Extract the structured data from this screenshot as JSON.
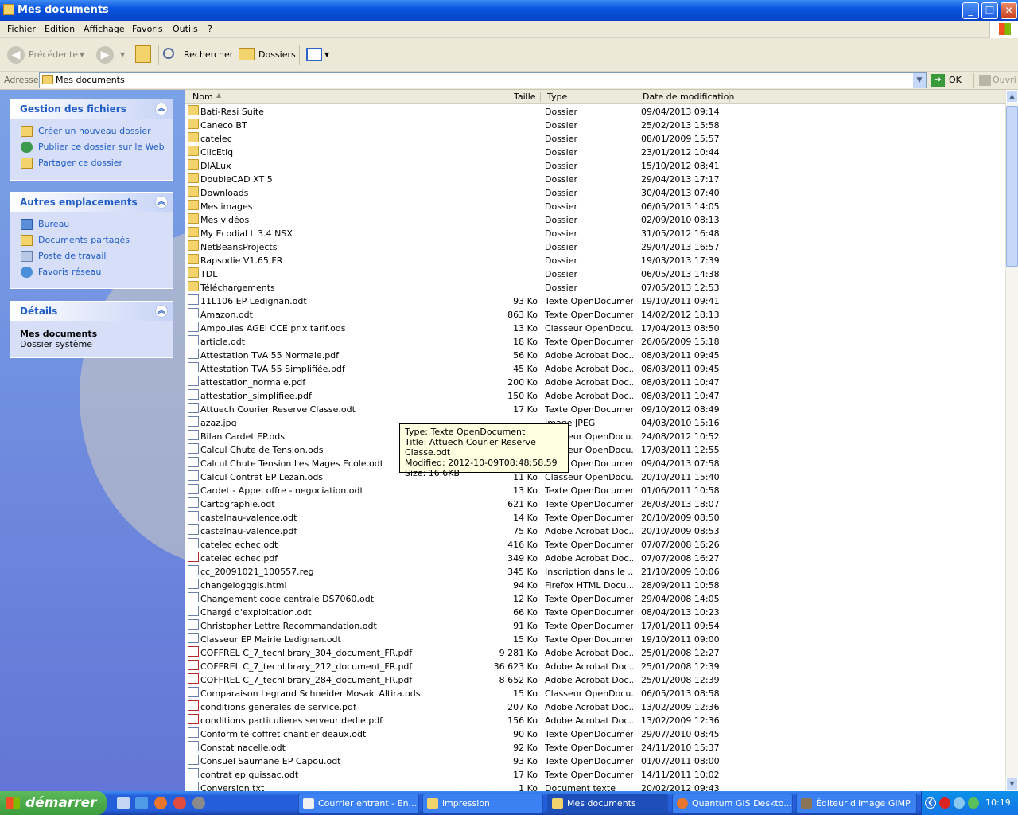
{
  "window": {
    "title": "Mes documents"
  },
  "menu": [
    "Fichier",
    "Edition",
    "Affichage",
    "Favoris",
    "Outils",
    "?"
  ],
  "toolbar": {
    "back": "Précédente",
    "search": "Rechercher",
    "folders": "Dossiers"
  },
  "address": {
    "label": "Adresse",
    "value": "Mes documents",
    "go": "OK",
    "open": "Ouvri"
  },
  "tasks_panel": {
    "title": "Gestion des fichiers",
    "items": [
      "Créer un nouveau dossier",
      "Publier ce dossier sur le Web",
      "Partager ce dossier"
    ]
  },
  "places_panel": {
    "title": "Autres emplacements",
    "items": [
      "Bureau",
      "Documents partagés",
      "Poste de travail",
      "Favoris réseau"
    ]
  },
  "details_panel": {
    "title": "Détails",
    "name": "Mes documents",
    "desc": "Dossier système"
  },
  "columns": {
    "name": "Nom",
    "size": "Taille",
    "type": "Type",
    "date": "Date de modification"
  },
  "files": [
    {
      "name": "Bati-Resi Suite",
      "size": "",
      "type": "Dossier",
      "date": "09/04/2013 09:14",
      "kind": "folder"
    },
    {
      "name": "Caneco BT",
      "size": "",
      "type": "Dossier",
      "date": "25/02/2013 15:58",
      "kind": "folder"
    },
    {
      "name": "catelec",
      "size": "",
      "type": "Dossier",
      "date": "08/01/2009 15:57",
      "kind": "folder"
    },
    {
      "name": "ClicEtiq",
      "size": "",
      "type": "Dossier",
      "date": "23/01/2012 10:44",
      "kind": "folder"
    },
    {
      "name": "DIALux",
      "size": "",
      "type": "Dossier",
      "date": "15/10/2012 08:41",
      "kind": "folder"
    },
    {
      "name": "DoubleCAD XT 5",
      "size": "",
      "type": "Dossier",
      "date": "29/04/2013 17:17",
      "kind": "folder"
    },
    {
      "name": "Downloads",
      "size": "",
      "type": "Dossier",
      "date": "30/04/2013 07:40",
      "kind": "folder"
    },
    {
      "name": "Mes images",
      "size": "",
      "type": "Dossier",
      "date": "06/05/2013 14:05",
      "kind": "folder"
    },
    {
      "name": "Mes vidéos",
      "size": "",
      "type": "Dossier",
      "date": "02/09/2010 08:13",
      "kind": "folder"
    },
    {
      "name": "My Ecodial L 3.4 NSX",
      "size": "",
      "type": "Dossier",
      "date": "31/05/2012 16:48",
      "kind": "folder"
    },
    {
      "name": "NetBeansProjects",
      "size": "",
      "type": "Dossier",
      "date": "29/04/2013 16:57",
      "kind": "folder"
    },
    {
      "name": "Rapsodie V1.65 FR",
      "size": "",
      "type": "Dossier",
      "date": "19/03/2013 17:39",
      "kind": "folder"
    },
    {
      "name": "TDL",
      "size": "",
      "type": "Dossier",
      "date": "06/05/2013 14:38",
      "kind": "folder"
    },
    {
      "name": "Téléchargements",
      "size": "",
      "type": "Dossier",
      "date": "07/05/2013 12:53",
      "kind": "folder"
    },
    {
      "name": "11L106 EP Ledignan.odt",
      "size": "93 Ko",
      "type": "Texte OpenDocument",
      "date": "19/10/2011 09:41",
      "kind": "doc"
    },
    {
      "name": "Amazon.odt",
      "size": "863 Ko",
      "type": "Texte OpenDocument",
      "date": "14/02/2012 18:13",
      "kind": "doc"
    },
    {
      "name": "Ampoules AGEI CCE prix tarif.ods",
      "size": "13 Ko",
      "type": "Classeur OpenDocu...",
      "date": "17/04/2013 08:50",
      "kind": "doc"
    },
    {
      "name": "article.odt",
      "size": "18 Ko",
      "type": "Texte OpenDocument",
      "date": "26/06/2009 15:18",
      "kind": "doc"
    },
    {
      "name": "Attestation TVA 55 Normale.pdf",
      "size": "56 Ko",
      "type": "Adobe Acrobat Doc...",
      "date": "08/03/2011 09:45",
      "kind": "doc"
    },
    {
      "name": "Attestation TVA 55 Simplifiée.pdf",
      "size": "45 Ko",
      "type": "Adobe Acrobat Doc...",
      "date": "08/03/2011 09:45",
      "kind": "doc"
    },
    {
      "name": "attestation_normale.pdf",
      "size": "200 Ko",
      "type": "Adobe Acrobat Doc...",
      "date": "08/03/2011 10:47",
      "kind": "doc"
    },
    {
      "name": "attestation_simplifiee.pdf",
      "size": "150 Ko",
      "type": "Adobe Acrobat Doc...",
      "date": "08/03/2011 10:47",
      "kind": "doc"
    },
    {
      "name": "Attuech Courier Reserve Classe.odt",
      "size": "17 Ko",
      "type": "Texte OpenDocument",
      "date": "09/10/2012 08:49",
      "kind": "doc"
    },
    {
      "name": "azaz.jpg",
      "size": "",
      "type": "Image JPEG",
      "date": "04/03/2010 15:16",
      "kind": "doc"
    },
    {
      "name": "Bilan Cardet EP.ods",
      "size": "",
      "type": "Classeur OpenDocu...",
      "date": "24/08/2012 10:52",
      "kind": "doc"
    },
    {
      "name": "Calcul Chute de Tension.ods",
      "size": "",
      "type": "Classeur OpenDocu...",
      "date": "17/03/2011 12:55",
      "kind": "doc"
    },
    {
      "name": "Calcul Chute Tension Les Mages Ecole.odt",
      "size": "",
      "type": "Texte OpenDocument",
      "date": "09/04/2013 07:58",
      "kind": "doc"
    },
    {
      "name": "Calcul Contrat EP Lezan.ods",
      "size": "11 Ko",
      "type": "Classeur OpenDocu...",
      "date": "20/10/2011 15:40",
      "kind": "doc"
    },
    {
      "name": "Cardet - Appel offre - negociation.odt",
      "size": "13 Ko",
      "type": "Texte OpenDocument",
      "date": "01/06/2011 10:58",
      "kind": "doc"
    },
    {
      "name": "Cartographie.odt",
      "size": "621 Ko",
      "type": "Texte OpenDocument",
      "date": "26/03/2013 18:07",
      "kind": "doc"
    },
    {
      "name": "castelnau-valence.odt",
      "size": "14 Ko",
      "type": "Texte OpenDocument",
      "date": "20/10/2009 08:50",
      "kind": "doc"
    },
    {
      "name": "castelnau-valence.pdf",
      "size": "75 Ko",
      "type": "Adobe Acrobat Doc...",
      "date": "20/10/2009 08:53",
      "kind": "doc"
    },
    {
      "name": "catelec echec.odt",
      "size": "416 Ko",
      "type": "Texte OpenDocument",
      "date": "07/07/2008 16:26",
      "kind": "doc"
    },
    {
      "name": "catelec echec.pdf",
      "size": "349 Ko",
      "type": "Adobe Acrobat Doc...",
      "date": "07/07/2008 16:27",
      "kind": "pdf"
    },
    {
      "name": "cc_20091021_100557.reg",
      "size": "345 Ko",
      "type": "Inscription dans le ...",
      "date": "21/10/2009 10:06",
      "kind": "doc"
    },
    {
      "name": "changelogqgis.html",
      "size": "94 Ko",
      "type": "Firefox HTML Docu...",
      "date": "28/09/2011 10:58",
      "kind": "doc"
    },
    {
      "name": "Changement code centrale DS7060.odt",
      "size": "12 Ko",
      "type": "Texte OpenDocument",
      "date": "29/04/2008 14:05",
      "kind": "doc"
    },
    {
      "name": "Chargé d'exploitation.odt",
      "size": "66 Ko",
      "type": "Texte OpenDocument",
      "date": "08/04/2013 10:23",
      "kind": "doc"
    },
    {
      "name": "Christopher Lettre Recommandation.odt",
      "size": "91 Ko",
      "type": "Texte OpenDocument",
      "date": "17/01/2011 09:54",
      "kind": "doc"
    },
    {
      "name": "Classeur EP Mairie Ledignan.odt",
      "size": "15 Ko",
      "type": "Texte OpenDocument",
      "date": "19/10/2011 09:00",
      "kind": "doc"
    },
    {
      "name": "COFFREL C_7_techlibrary_304_document_FR.pdf",
      "size": "9 281 Ko",
      "type": "Adobe Acrobat Doc...",
      "date": "25/01/2008 12:27",
      "kind": "pdf"
    },
    {
      "name": "COFFREL C_7_techlibrary_212_document_FR.pdf",
      "size": "36 623 Ko",
      "type": "Adobe Acrobat Doc...",
      "date": "25/01/2008 12:39",
      "kind": "pdf"
    },
    {
      "name": "COFFREL C_7_techlibrary_284_document_FR.pdf",
      "size": "8 652 Ko",
      "type": "Adobe Acrobat Doc...",
      "date": "25/01/2008 12:39",
      "kind": "pdf"
    },
    {
      "name": "Comparaison Legrand Schneider Mosaic Altira.ods",
      "size": "15 Ko",
      "type": "Classeur OpenDocu...",
      "date": "06/05/2013 08:58",
      "kind": "doc"
    },
    {
      "name": "conditions generales de service.pdf",
      "size": "207 Ko",
      "type": "Adobe Acrobat Doc...",
      "date": "13/02/2009 12:36",
      "kind": "pdf"
    },
    {
      "name": "conditions particulieres serveur dedie.pdf",
      "size": "156 Ko",
      "type": "Adobe Acrobat Doc...",
      "date": "13/02/2009 12:36",
      "kind": "pdf"
    },
    {
      "name": "Conformité coffret chantier deaux.odt",
      "size": "90 Ko",
      "type": "Texte OpenDocument",
      "date": "29/07/2010 08:45",
      "kind": "doc"
    },
    {
      "name": "Constat nacelle.odt",
      "size": "92 Ko",
      "type": "Texte OpenDocument",
      "date": "24/11/2010 15:37",
      "kind": "doc"
    },
    {
      "name": "Consuel Saumane EP Capou.odt",
      "size": "93 Ko",
      "type": "Texte OpenDocument",
      "date": "01/07/2011 08:00",
      "kind": "doc"
    },
    {
      "name": "contrat ep quissac.odt",
      "size": "17 Ko",
      "type": "Texte OpenDocument",
      "date": "14/11/2011 10:02",
      "kind": "doc"
    },
    {
      "name": "Conversion.txt",
      "size": "1 Ko",
      "type": "Document texte",
      "date": "20/02/2012 09:43",
      "kind": "doc"
    }
  ],
  "tooltip": [
    "Type: Texte OpenDocument",
    "Title: Attuech Courier Reserve Classe.odt",
    "Modified: 2012-10-09T08:48:58.59",
    "Size: 16.6KB"
  ],
  "taskbar": {
    "start": "démarrer",
    "tasks": [
      "Courrier entrant - En...",
      "impression",
      "Mes documents",
      "Quantum GIS Deskto...",
      "Éditeur d'image GIMP"
    ],
    "clock": "10:19"
  }
}
